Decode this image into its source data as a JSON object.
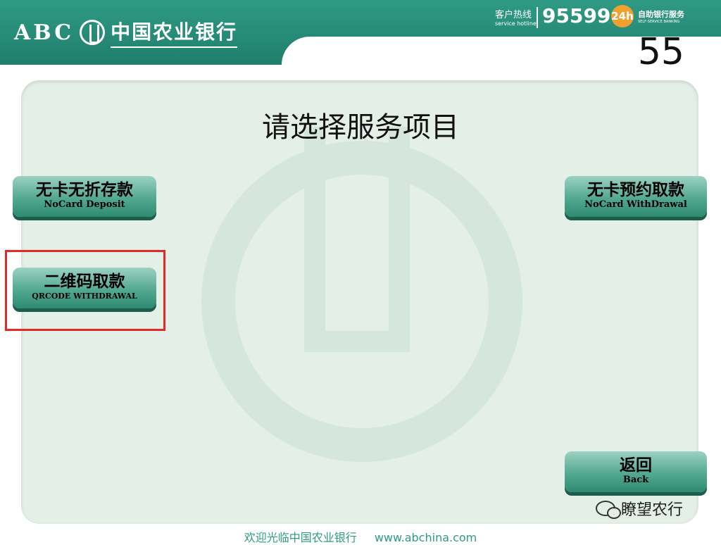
{
  "header": {
    "brand_latin": "ABC",
    "brand_name": "中国农业银行",
    "hotline_label": "客户热线",
    "hotline_sub": "service hotline",
    "hotline_number": "95599",
    "badge": "24h",
    "selfservice_label": "自助银行服务",
    "selfservice_sub": "SELF-SERVICE BANKING"
  },
  "countdown": "55",
  "title": "请选择服务项目",
  "buttons": {
    "nocard_deposit": {
      "cn": "无卡无折存款",
      "en": "NoCard Deposit"
    },
    "qrcode_withdrawal": {
      "cn": "二维码取款",
      "en": "QRCODE WITHDRAWAL"
    },
    "nocard_withdrawal": {
      "cn": "无卡预约取款",
      "en": "NoCard WithDrawal"
    },
    "back": {
      "cn": "返回",
      "en": "Back"
    }
  },
  "footer": {
    "welcome": "欢迎光临中国农业银行",
    "url": "www.abchina.com"
  },
  "wechat_watermark": "瞭望农行",
  "colors": {
    "brand_green": "#2f9a84",
    "button_green": "#53a890",
    "highlight_red": "#e22a2a"
  }
}
